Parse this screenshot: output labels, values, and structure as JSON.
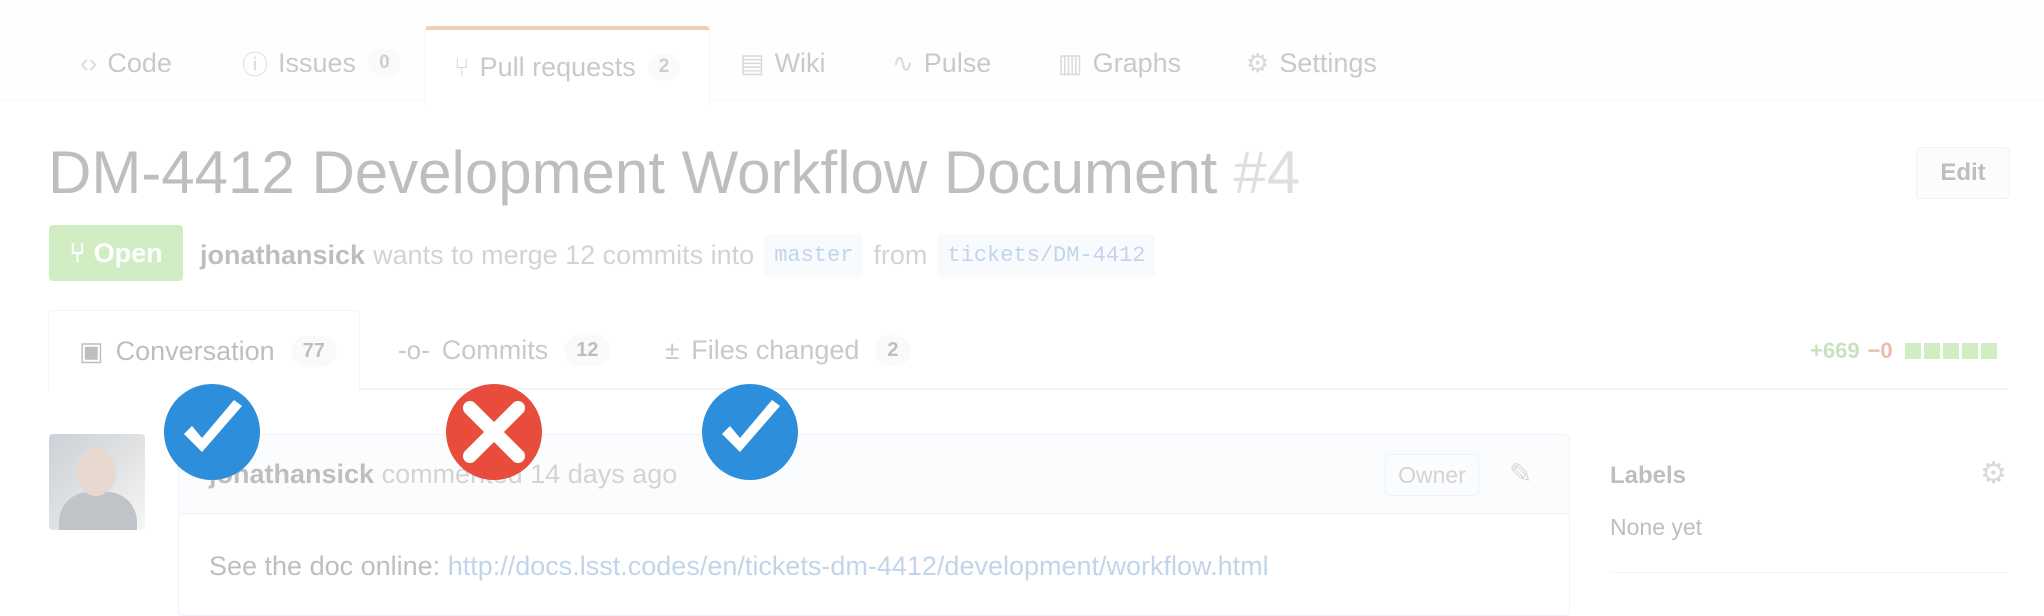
{
  "repo_nav": {
    "tabs": [
      {
        "icon": "code-icon",
        "glyph": "‹›",
        "label": "Code"
      },
      {
        "icon": "issue-icon",
        "glyph": "ⓘ",
        "label": "Issues",
        "count": "0"
      },
      {
        "icon": "pull-request-icon",
        "glyph": "⑂",
        "label": "Pull requests",
        "count": "2"
      },
      {
        "icon": "wiki-icon",
        "glyph": "▤",
        "label": "Wiki"
      },
      {
        "icon": "pulse-icon",
        "glyph": "∿",
        "label": "Pulse"
      },
      {
        "icon": "graph-icon",
        "glyph": "▥",
        "label": "Graphs"
      },
      {
        "icon": "gear-icon",
        "glyph": "⚙",
        "label": "Settings"
      }
    ],
    "selected": "Pull requests"
  },
  "pr": {
    "title": "DM-4412 Development Workflow Document",
    "number": "#4",
    "edit_label": "Edit",
    "state": "Open",
    "state_icon": "pull-request-icon",
    "state_color": "#6cc644",
    "author": "jonathansick",
    "meta_text": "wants to merge 12 commits into",
    "base_branch": "master",
    "from_text": "from",
    "head_branch": "tickets/DM-4412"
  },
  "pr_tabs": [
    {
      "icon": "comment-icon",
      "glyph": "💬",
      "label": "Conversation",
      "count": "77",
      "status": "pass"
    },
    {
      "icon": "commit-icon",
      "glyph": "-o-",
      "label": "Commits",
      "count": "12",
      "status": "fail"
    },
    {
      "icon": "file-diff-icon",
      "glyph": "±",
      "label": "Files changed",
      "count": "2",
      "status": "pass"
    }
  ],
  "diffstat": {
    "additions": "+669",
    "deletions": "−0",
    "blocks": 5
  },
  "comment": {
    "author": "jonathansick",
    "action": "commented",
    "time": "14 days ago",
    "role": "Owner",
    "body_prefix": "See the doc online:",
    "link": "http://docs.lsst.codes/en/tickets-dm-4412/development/workflow.html"
  },
  "sidebar": {
    "labels_title": "Labels",
    "labels_value": "None yet"
  },
  "colors": {
    "pass": "#2d8fdb",
    "fail": "#e84c3d",
    "accent": "#d26911",
    "link": "#4078c0"
  }
}
